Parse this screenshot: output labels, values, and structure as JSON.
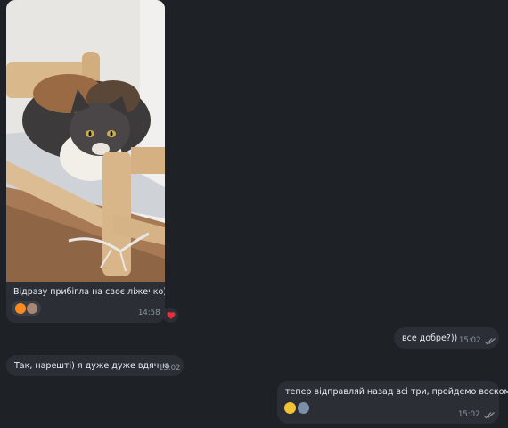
{
  "messages": [
    {
      "id": "photo",
      "caption": "Відразу прибігла на своє ліжечко)",
      "time": "14:58",
      "reaction_icons": [
        "fire",
        "avatar-photo"
      ],
      "side_reaction": "heart"
    },
    {
      "id": "out1",
      "text": "все добре?))",
      "time": "15:02",
      "status": "read"
    },
    {
      "id": "in2",
      "text": "Так, нарешті) я дуже дуже вдячна",
      "time": "15:02"
    },
    {
      "id": "out2",
      "text": "тепер відправляй назад всі три, пройдемо воском))",
      "time": "15:02",
      "status": "read",
      "reaction_icons": [
        "grimace",
        "avatar-photo"
      ]
    }
  ],
  "colors": {
    "background": "#1e2126",
    "bubble": "#2b2f35",
    "text": "#e9edf1",
    "meta": "#8b949e",
    "heart": "#e0303b"
  }
}
